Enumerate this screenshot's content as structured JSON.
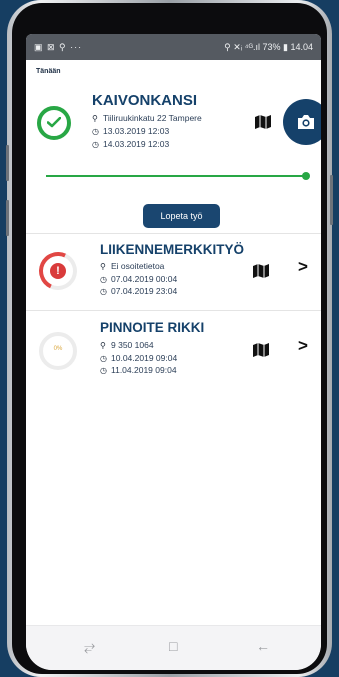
{
  "status": {
    "left_icons": "▣ ⊠ ⚲  ···",
    "right_text": "⚲ ✕ᵢ ⁴ᴳ.ıl 73% ▮ 14.04"
  },
  "section_label": "Tänään",
  "active_task": {
    "title": "KAIVONKANSI",
    "address": "Tiiliruukinkatu 22 Tampere",
    "start": "13.03.2019 12:03",
    "end": "14.03.2019 12:03",
    "progress_fraction": 1.0,
    "stop_button": "Lopeta työ",
    "status_color": "#28a745"
  },
  "tasks": [
    {
      "title": "LIIKENNEMERKKITYÖ",
      "address": "Ei osoitetietoa",
      "start": "07.04.2019 00:04",
      "end": "07.04.2019 23:04",
      "status": "warning",
      "status_symbol": "!"
    },
    {
      "title": "PINNOITE RIKKI",
      "address": "9 350 1064",
      "start": "10.04.2019 09:04",
      "end": "11.04.2019 09:04",
      "status": "progress",
      "progress_label": "0%"
    }
  ],
  "icons": {
    "pin": "📍",
    "clock": "◷",
    "chevron": "›",
    "nav_recent": "⥂",
    "nav_home": "□",
    "nav_back": "←"
  },
  "colors": {
    "brand": "#15416a",
    "success": "#28a745",
    "danger": "#e14744"
  }
}
